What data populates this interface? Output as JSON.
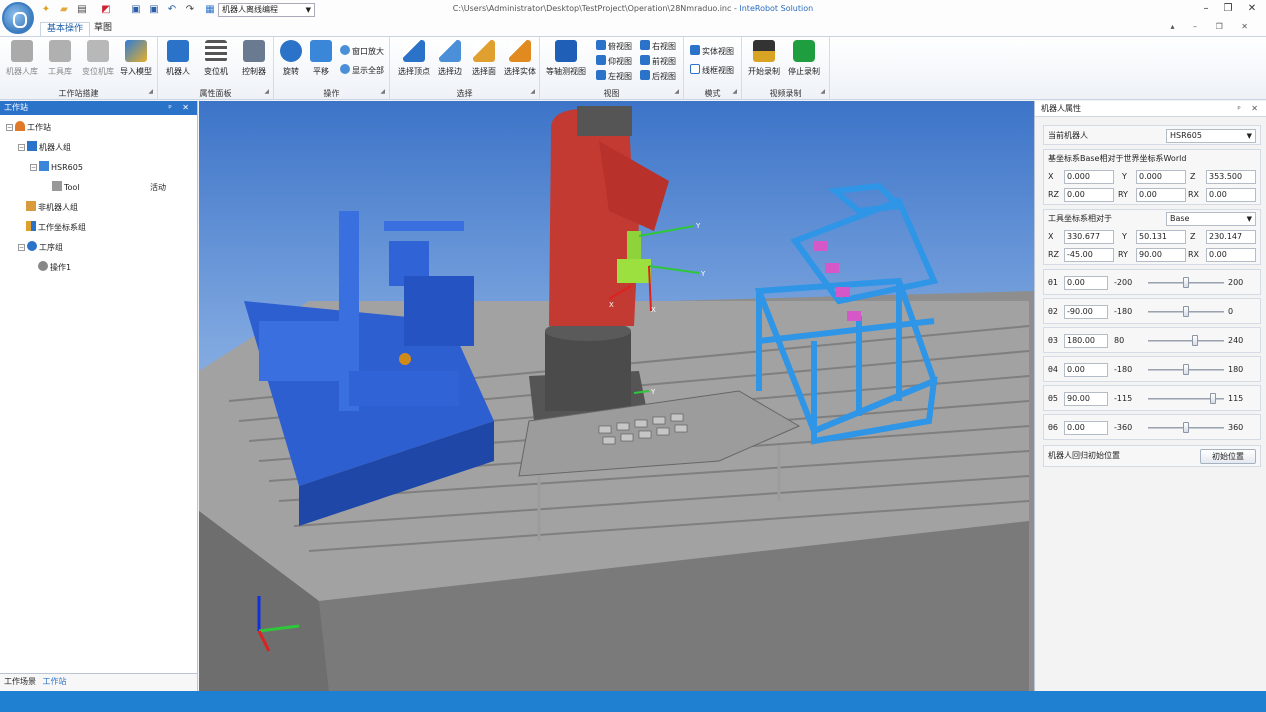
{
  "window": {
    "title_path": "C:\\Users\\Administrator\\Desktop\\TestProject\\Operation\\28Nmraduo.inc - ",
    "title_brand": "InteRobot Solution",
    "project_select": "机器人离线编程",
    "minimize": "–",
    "maximize": "❐",
    "close": "✕"
  },
  "ribbon_tabs": [
    "基本操作",
    "草图"
  ],
  "ribbon_right": "▴ – ❐ ✕",
  "ribbon": {
    "groups": [
      {
        "label": "工作站搭建",
        "buttons": [
          "机器人库",
          "工具库",
          "变位机库",
          "导入模型"
        ]
      },
      {
        "label": "属性面板",
        "buttons": [
          "机器人",
          "变位机",
          "控制器"
        ]
      },
      {
        "label": "操作",
        "buttons": [
          "旋转",
          "平移"
        ],
        "small": [
          "窗口放大",
          "显示全部"
        ]
      },
      {
        "label": "选择",
        "buttons": [
          "选择顶点",
          "选择边",
          "选择面",
          "选择实体"
        ]
      },
      {
        "label": "视图",
        "buttons": [
          "等轴测视图"
        ],
        "small": [
          "俯视图",
          "右视图",
          "仰视图",
          "前视图",
          "左视图",
          "后视图"
        ]
      },
      {
        "label": "模式",
        "small": [
          "实体视图",
          "线框视图"
        ]
      },
      {
        "label": "视频录制",
        "buttons": [
          "开始录制",
          "停止录制"
        ]
      }
    ],
    "launcher": "◢"
  },
  "left_panel": {
    "title": "工作站",
    "header_buttons": "ᵖ ✕",
    "tree": [
      {
        "label": "工作站",
        "toggle": "−"
      },
      {
        "label": "机器人组",
        "toggle": "−"
      },
      {
        "label": "HSR605",
        "toggle": "−"
      },
      {
        "label": "Tool",
        "status": "活动"
      },
      {
        "label": "非机器人组"
      },
      {
        "label": "工作坐标系组"
      },
      {
        "label": "工序组",
        "toggle": "−"
      },
      {
        "label": "操作1"
      }
    ],
    "footer_tabs": [
      "工作场景",
      "工作站"
    ]
  },
  "right_panel": {
    "title": "机器人属性",
    "header_buttons": "ᵖ ✕",
    "current_robot_label": "当前机器人",
    "current_robot": "HSR605",
    "base_section_label": "基坐标系Base相对于世界坐标系World",
    "base": {
      "X": "0.000",
      "Y": "0.000",
      "Z": "353.500",
      "RZ": "0.00",
      "RY": "0.00",
      "RX": "0.00"
    },
    "tool_section_label": "工具坐标系相对于",
    "tool_ref": "Base",
    "tool": {
      "X": "330.677",
      "Y": "50.131",
      "Z": "230.147",
      "RZ": "-45.00",
      "RY": "90.00",
      "RX": "0.00"
    },
    "axis_labels": {
      "X": "X",
      "Y": "Y",
      "Z": "Z",
      "RZ": "RZ",
      "RY": "RY",
      "RX": "RX"
    },
    "joints": [
      {
        "name": "θ1",
        "value": "0.00",
        "min": "-200",
        "max": "200",
        "level": 0.5
      },
      {
        "name": "θ2",
        "value": "-90.00",
        "min": "-180",
        "max": "0",
        "level": 0.5
      },
      {
        "name": "θ3",
        "value": "180.00",
        "min": "80",
        "max": "240",
        "level": 0.625
      },
      {
        "name": "θ4",
        "value": "0.00",
        "min": "-180",
        "max": "180",
        "level": 0.5
      },
      {
        "name": "θ5",
        "value": "90.00",
        "min": "-115",
        "max": "115",
        "level": 0.89
      },
      {
        "name": "θ6",
        "value": "0.00",
        "min": "-360",
        "max": "360",
        "level": 0.5
      }
    ],
    "home_label": "机器人回归初始位置",
    "home_button": "初始位置"
  },
  "viewport": {
    "gizmo_labels": [
      "Y",
      "Y",
      "X",
      "X",
      "Y",
      "Z"
    ]
  },
  "colors": {
    "ribbon_accent": "#2b73c9",
    "robot_red": "#c23a32",
    "fixture_blue": "#2c5fcf",
    "rack_blue": "#2f95e6",
    "table_gray": "#9a9a9a",
    "statusbar": "#1f7fd1"
  }
}
